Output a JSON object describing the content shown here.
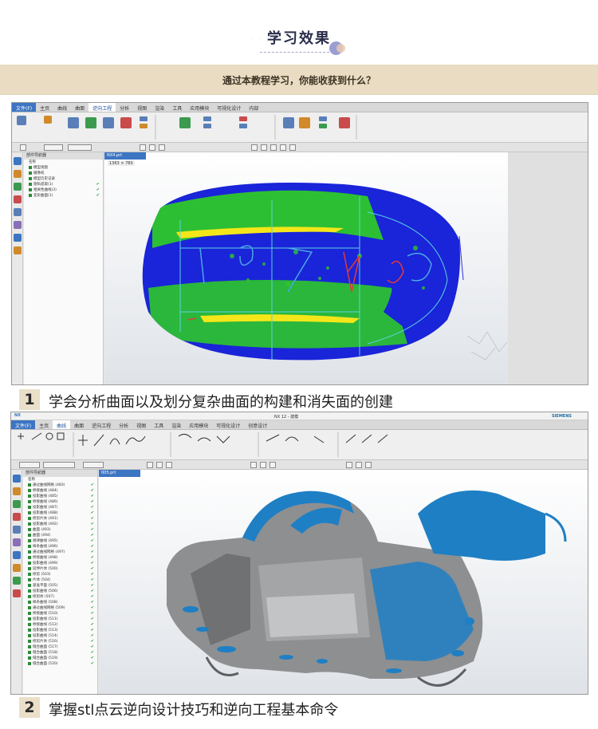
{
  "header": {
    "title": "学习效果",
    "banner_text": "通过本教程学习，你能收获到什么？"
  },
  "screenshot1": {
    "ribbon_tabs": [
      "文件(F)",
      "主页",
      "曲线",
      "曲面",
      "逆向工程",
      "分析",
      "视图",
      "渲染",
      "工具",
      "应用模块",
      "可视化设计",
      "内部"
    ],
    "active_tab": "逆向工程",
    "nav_panel_title": "部件导航器",
    "nav_rows": [
      "名称",
      "模型视图",
      "摄像机",
      "模型历史记录",
      "隐私提取(1)",
      "相关性曲线(3)",
      "变形曲面(1)"
    ],
    "viewport_tab": "NX4.prt",
    "viewport_size": "1363 × 780"
  },
  "caption1": {
    "number": "1",
    "text": "学会分析曲面以及划分复杂曲面的构建和消失面的创建"
  },
  "screenshot2": {
    "app_title": "NX 12 - 建模",
    "brand": "SIEMENS",
    "ribbon_tabs": [
      "文件(F)",
      "主页",
      "曲线",
      "曲面",
      "逆向工程",
      "分析",
      "视图",
      "工具",
      "渲染",
      "应用模块",
      "可视化设计",
      "创意设计"
    ],
    "active_tab": "曲线",
    "nav_panel_title": "部件导航器",
    "nav_rows": [
      "名称",
      "通过曲线网格 (483)",
      "桥接曲线 (484)",
      "投影曲线 (485)",
      "桥接曲线 (486)",
      "投影曲线 (487)",
      "投影曲线 (488)",
      "修剪片体 (491)",
      "投影曲线 (492)",
      "曲面 (493)",
      "曲面 (494)",
      "规律曲线 (495)",
      "样条曲线 (496)",
      "通过曲线网格 (497)",
      "桥接曲线 (498)",
      "投影曲线 (499)",
      "延伸片体 (500)",
      "修剪 (503)",
      "片体 (504)",
      "基准平面 (505)",
      "投影曲线 (506)",
      "修剪体 (507)",
      "样条曲线 (508)",
      "通过曲线网格 (509)",
      "桥接曲线 (510)",
      "投影曲线 (511)",
      "桥接曲线 (512)",
      "投影曲线 (513)",
      "投影曲线 (514)",
      "修剪片体 (516)",
      "缝合曲面 (517)",
      "缝合曲面 (518)",
      "缝合曲面 (519)",
      "缝合曲面 (520)"
    ],
    "viewport_tab": "005.prt"
  },
  "caption2": {
    "number": "2",
    "text": "掌握stl点云逆向设计技巧和逆向工程基本命令"
  },
  "colors": {
    "title": "#2a2d4a",
    "banner": "#e9dcc2",
    "number_box": "#eadfc8",
    "surface_blue": "#1a24d8",
    "surface_green": "#2ec82a",
    "surface_yellow": "#f5e61a",
    "car_blue": "#1f7fc4",
    "car_gray": "#8d8f91"
  }
}
